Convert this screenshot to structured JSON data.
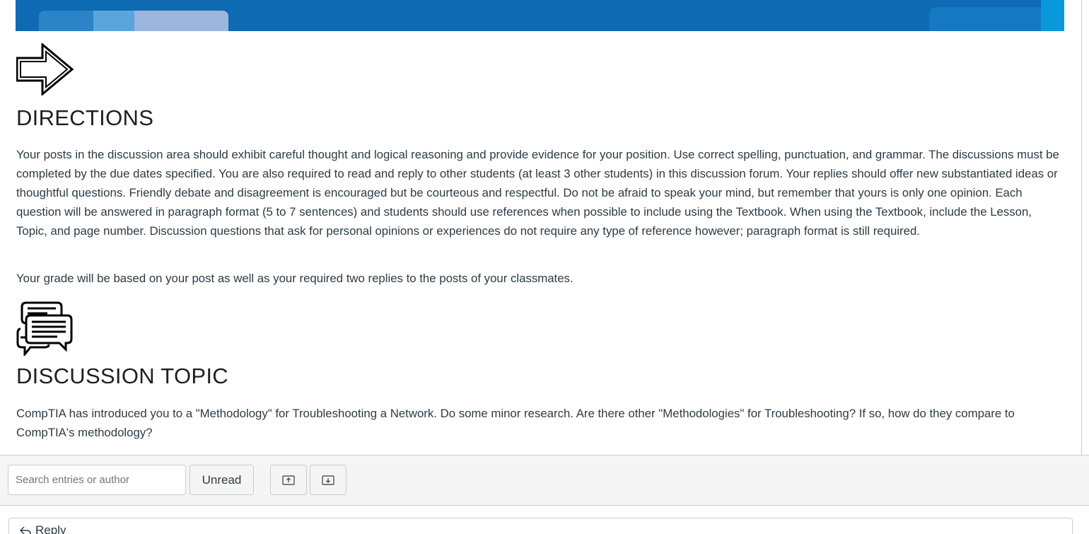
{
  "directions": {
    "heading": "DIRECTIONS",
    "paragraph1": "Your posts in the discussion area should exhibit careful thought and logical reasoning and provide evidence for your position. Use correct spelling, punctuation, and grammar. The discussions must be completed by the due dates specified. You are also required to read and reply to other students (at least 3 other students) in this discussion forum. Your replies should offer new substantiated ideas or thoughtful questions. Friendly debate and disagreement is encouraged but be courteous and respectful. Do not be afraid to speak your mind, but remember that yours is only one opinion. Each question will be answered in paragraph format (5 to 7 sentences) and students should use references when possible to include using the Textbook. When using the Textbook, include the Lesson, Topic, and page number. Discussion questions that ask for personal opinions or experiences do not require any type of reference however; paragraph format is still required.",
    "paragraph2": "Your grade will be based on your post as well as your required two replies to the posts of your classmates."
  },
  "topic": {
    "heading": "DISCUSSION TOPIC",
    "paragraph": "CompTIA has introduced you to a \"Methodology\" for Troubleshooting a Network. Do some minor research. Are there other \"Methodologies\" for Troubleshooting? If so, how do they compare to CompTIA's methodology?"
  },
  "toolbar": {
    "search_placeholder": "Search entries or author",
    "search_value": "",
    "unread_label": "Unread",
    "collapse_icon": "collapse-all-icon",
    "expand_icon": "expand-all-icon"
  },
  "reply": {
    "label": "Reply",
    "icon": "reply-arrow-icon"
  },
  "colors": {
    "banner_primary": "#0e6ab3",
    "text": "#2d3b45",
    "toolbar_bg": "#f5f5f5",
    "border": "#c7cdd1"
  }
}
